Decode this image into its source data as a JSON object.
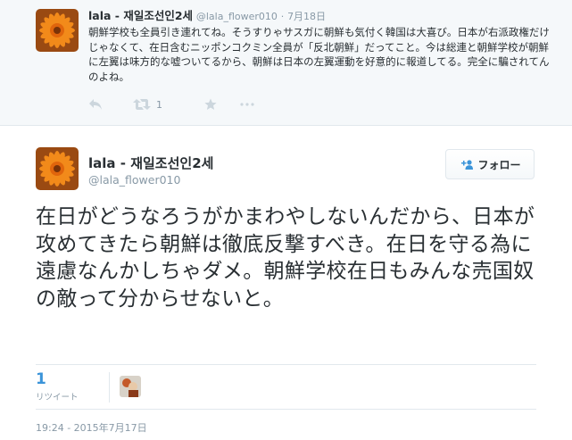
{
  "parent_tweet": {
    "display_name": "lala - 재일조선인2세",
    "handle": "@lala_flower010",
    "separator": "·",
    "time": "7月18日",
    "text": "朝鮮学校も全員引き連れてね。そうすりゃサスガに朝鮮も気付く韓国は大喜び。日本が右派政権だけじゃなくて、在日含むニッポンコクミン全員が「反北朝鮮」だってこと。今は総連と朝鮮学校が朝鮮に左翼は味方的な嘘ついてるから、朝鮮は日本の左翼運動を好意的に報道してる。完全に騙されてんのよね。",
    "retweet_count": "1",
    "icons": [
      "reply-icon",
      "retweet-icon",
      "favorite-icon",
      "more-icon"
    ]
  },
  "main_tweet": {
    "display_name": "lala - 재일조선인2세",
    "handle": "@lala_flower010",
    "follow_label": "フォロー",
    "text": "在日がどうなろうがかまわやしないんだから、日本が攻めてきたら朝鮮は徹底反撃すべき。在日を守る為に遠慮なんかしちゃダメ。朝鮮学校在日もみんな売国奴の敵って分からせないと。",
    "retweet_count": "1",
    "retweet_label": "リツイート",
    "timestamp": "19:24 - 2015年7月17日"
  },
  "colors": {
    "link_blue": "#3b94d9",
    "muted_gray": "#8899a6",
    "text_dark": "#292f33",
    "parent_bg": "#f5f8fa",
    "avatar_orange": "#f28a1a"
  }
}
